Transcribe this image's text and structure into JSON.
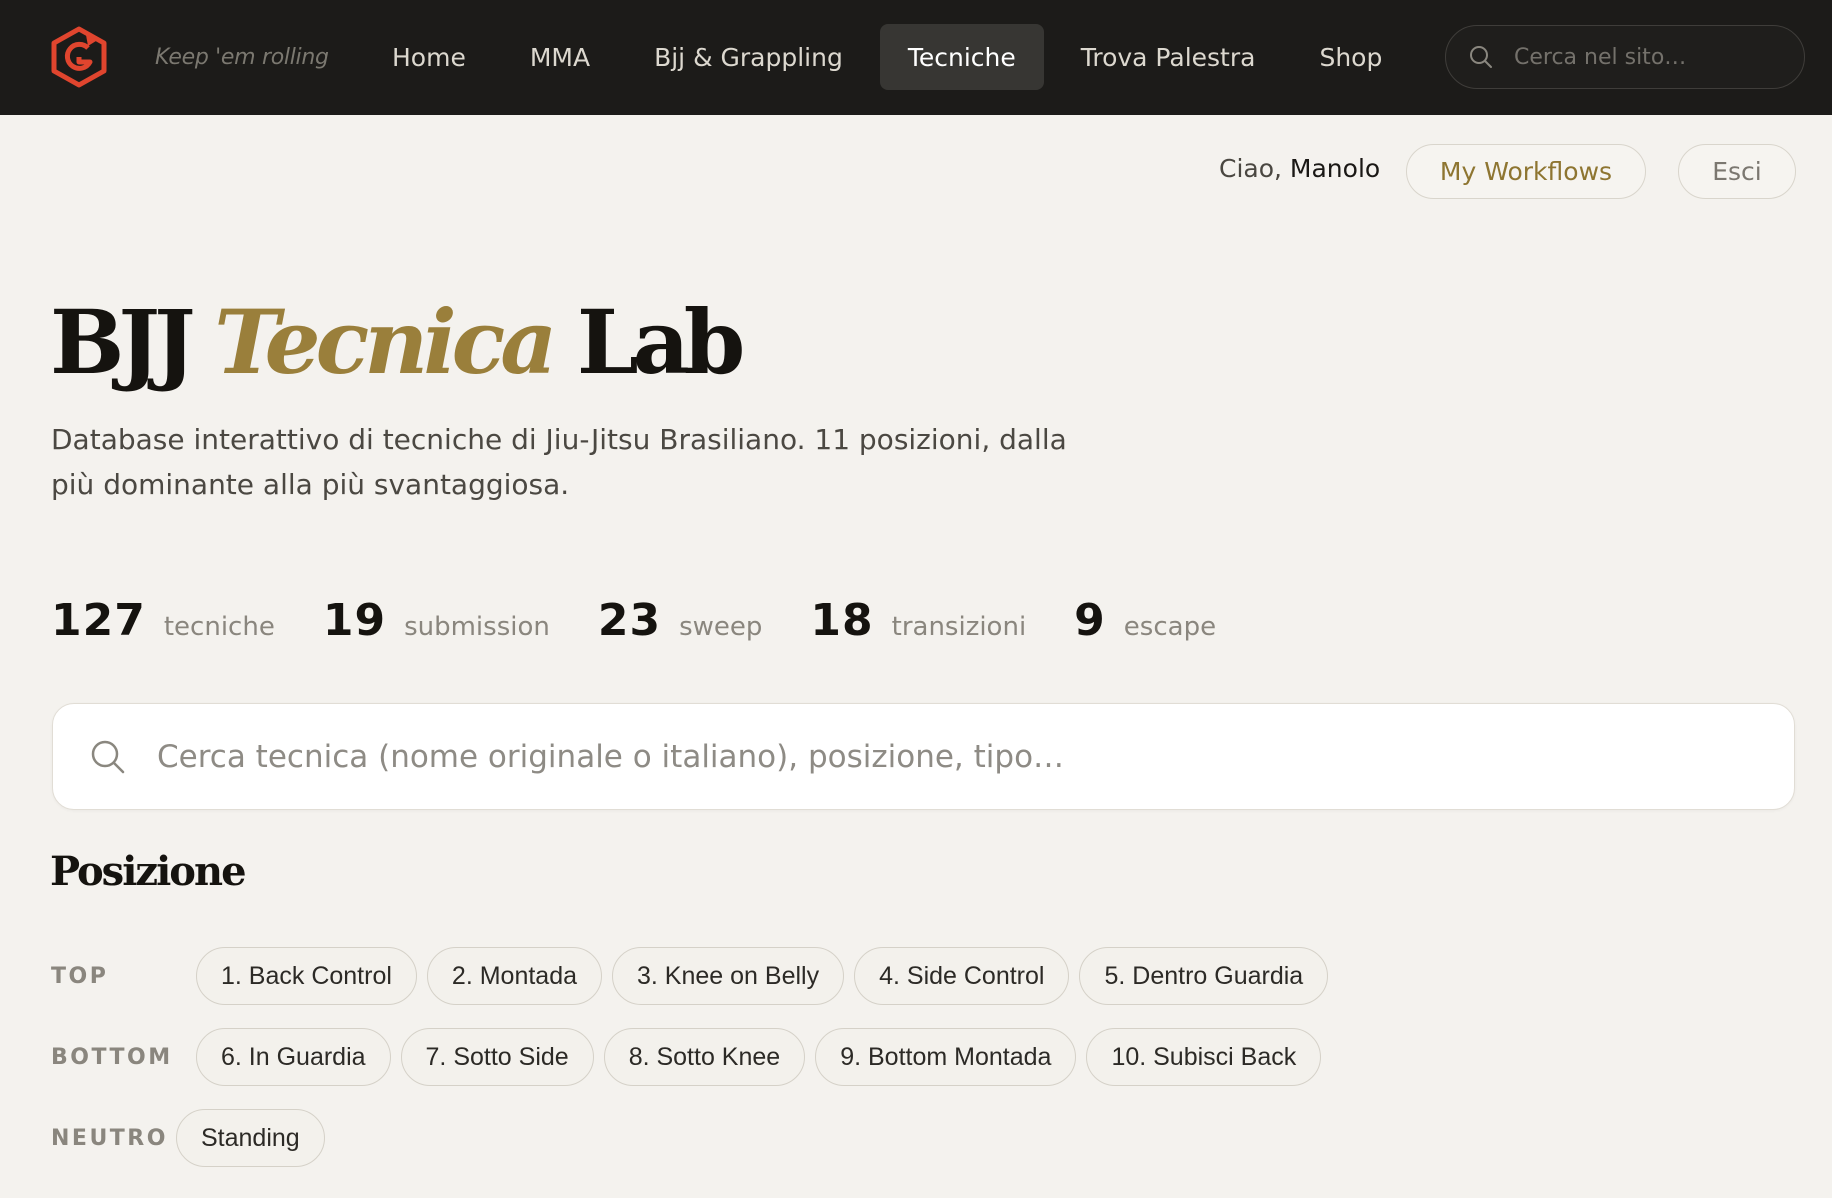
{
  "header": {
    "tagline": "Keep 'em rolling",
    "nav": [
      {
        "label": "Home",
        "active": false
      },
      {
        "label": "MMA",
        "active": false
      },
      {
        "label": "Bjj & Grappling",
        "active": false
      },
      {
        "label": "Tecniche",
        "active": true
      },
      {
        "label": "Trova Palestra",
        "active": false
      },
      {
        "label": "Shop",
        "active": false
      }
    ],
    "search_placeholder": "Cerca nel sito…"
  },
  "userbar": {
    "greeting": "Ciao,",
    "username": "Manolo",
    "workflows_label": "My Workflows",
    "logout_label": "Esci"
  },
  "hero": {
    "title_part1": "BJJ",
    "title_accent": "Tecnica",
    "title_part2": "Lab",
    "subtitle": "Database interattivo di tecniche di Jiu-Jitsu Brasiliano. 11 posizioni, dalla più dominante alla più svantaggiosa."
  },
  "stats": [
    {
      "value": "127",
      "label": "tecniche"
    },
    {
      "value": "19",
      "label": "submission"
    },
    {
      "value": "23",
      "label": "sweep"
    },
    {
      "value": "18",
      "label": "transizioni"
    },
    {
      "value": "9",
      "label": "escape"
    }
  ],
  "technique_search": {
    "placeholder": "Cerca tecnica (nome originale o italiano), posizione, tipo…"
  },
  "positions": {
    "title": "Posizione",
    "groups": [
      {
        "label": "TOP",
        "items": [
          "1. Back Control",
          "2. Montada",
          "3. Knee on Belly",
          "4. Side Control",
          "5. Dentro Guardia"
        ]
      },
      {
        "label": "BOTTOM",
        "items": [
          "6. In Guardia",
          "7. Sotto Side",
          "8. Sotto Knee",
          "9. Bottom Montada",
          "10. Subisci Back"
        ]
      },
      {
        "label": "NEUTRO",
        "items": [
          "Standing"
        ]
      }
    ]
  },
  "colors": {
    "accent": "#9a7f3b",
    "brand_red": "#e0452e",
    "nav_bg": "#1c1b19",
    "page_bg": "#f4f2ee"
  }
}
